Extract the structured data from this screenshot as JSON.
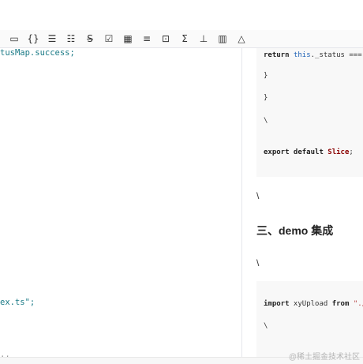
{
  "toolbar": {
    "icons": [
      "code-block-icon",
      "braces-icon",
      "bullet-list-icon",
      "ordered-list-icon",
      "strikethrough-icon",
      "checkbox-icon",
      "table-icon",
      "align-center-icon",
      "fullscreen-icon",
      "sigma-icon",
      "tree-icon",
      "grid-icon",
      "eraser-icon"
    ],
    "glyphs": [
      "▭",
      "{}",
      "☰",
      "☷",
      "S̶",
      "☑",
      "▦",
      "≡",
      "⊡",
      "Σ",
      "⊥",
      "▥",
      "△"
    ]
  },
  "editor": {
    "line1": "tusMap.success;",
    "line2": "ex.ts\";",
    "line3": ",,"
  },
  "preview": {
    "code1": {
      "line1_kw": "return",
      "line1_this": "this",
      "line1_rest": "._status === sta",
      "line2": "}",
      "line3": "}",
      "line4": "\\",
      "line5_kw": "export default",
      "line5_id": "Slice",
      "line5_end": ";"
    },
    "para1": "\\",
    "heading": "三、demo 集成",
    "para2": "\\",
    "code2": {
      "line1_kw": "import",
      "line1_mid": " xyUpload ",
      "line1_from": "from",
      "line1_str": "\"./inc",
      "line2": "\\"
    }
  },
  "watermark": "@稀土掘金技术社区"
}
